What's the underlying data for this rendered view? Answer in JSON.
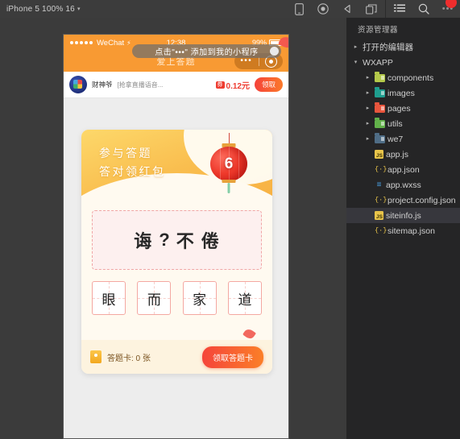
{
  "toolbar": {
    "device_selector": "iPhone 5 100% 16",
    "caret": "▾",
    "icons": [
      {
        "name": "device-icon",
        "glyph": "device"
      },
      {
        "name": "record-icon",
        "glyph": "record"
      },
      {
        "name": "sound-icon",
        "glyph": "sound"
      },
      {
        "name": "window-icon",
        "glyph": "window"
      },
      {
        "name": "menu-icon",
        "glyph": "menu"
      },
      {
        "name": "search-icon",
        "glyph": "search"
      }
    ],
    "more_dots": "•••"
  },
  "phone": {
    "status_bar": {
      "carrier": "WeChat",
      "wifi_glyph": "⚡",
      "time": "12:38",
      "battery_percent": "99%"
    },
    "nav_bar": {
      "title": "爱上答题",
      "capsule_dots": "•••"
    },
    "tooltip": {
      "text": "点击\"•••\" 添加到我的小程序"
    },
    "ad_banner": {
      "name": "财神爷",
      "desc": "[抢拿直播语音...",
      "tag": "券",
      "price": "0.12元",
      "button": "领取"
    },
    "quiz": {
      "head_line1": "参与答题",
      "head_line2": "答对领红包",
      "lantern_number": "6",
      "question": [
        "诲",
        "?",
        "不",
        "倦"
      ],
      "options": [
        "眼",
        "而",
        "家",
        "道"
      ],
      "ticket_label": "答题卡: 0 张",
      "claim_button": "领取答题卡"
    }
  },
  "sidebar": {
    "title": "资源管理器",
    "rows": [
      {
        "name": "open-editors",
        "label": "打开的编辑器",
        "kind": "section",
        "twisty": "▸",
        "indent": 0,
        "selected": false
      },
      {
        "name": "wxapp-root",
        "label": "WXAPP",
        "kind": "section",
        "twisty": "▾",
        "indent": 0,
        "selected": false
      },
      {
        "name": "folder-components",
        "label": "components",
        "kind": "folder",
        "color": "#b4c94a",
        "twisty": "▸",
        "indent": 12,
        "selected": false
      },
      {
        "name": "folder-images",
        "label": "images",
        "kind": "folder",
        "color": "#1f9e8f",
        "twisty": "▸",
        "indent": 12,
        "selected": false
      },
      {
        "name": "folder-pages",
        "label": "pages",
        "kind": "folder",
        "color": "#e8553d",
        "twisty": "▸",
        "indent": 12,
        "selected": false
      },
      {
        "name": "folder-utils",
        "label": "utils",
        "kind": "folder",
        "color": "#62b14a",
        "twisty": "▸",
        "indent": 12,
        "selected": false
      },
      {
        "name": "folder-we7",
        "label": "we7",
        "kind": "folder",
        "color": "#4f6d86",
        "twisty": "▸",
        "indent": 12,
        "selected": false
      },
      {
        "name": "file-app-js",
        "label": "app.js",
        "kind": "js",
        "icon_text": "JS",
        "twisty": "",
        "indent": 12,
        "selected": false
      },
      {
        "name": "file-app-json",
        "label": "app.json",
        "kind": "json",
        "icon_text": "{·}",
        "twisty": "",
        "indent": 12,
        "selected": false
      },
      {
        "name": "file-app-wxss",
        "label": "app.wxss",
        "kind": "wxss",
        "icon_text": "≡",
        "twisty": "",
        "indent": 12,
        "selected": false
      },
      {
        "name": "file-project-config",
        "label": "project.config.json",
        "kind": "json",
        "icon_text": "{·}",
        "twisty": "",
        "indent": 12,
        "selected": false
      },
      {
        "name": "file-siteinfo-js",
        "label": "siteinfo.js",
        "kind": "js",
        "icon_text": "JS",
        "twisty": "",
        "indent": 12,
        "selected": true
      },
      {
        "name": "file-sitemap-json",
        "label": "sitemap.json",
        "kind": "json",
        "icon_text": "{·}",
        "twisty": "",
        "indent": 12,
        "selected": false
      }
    ]
  }
}
